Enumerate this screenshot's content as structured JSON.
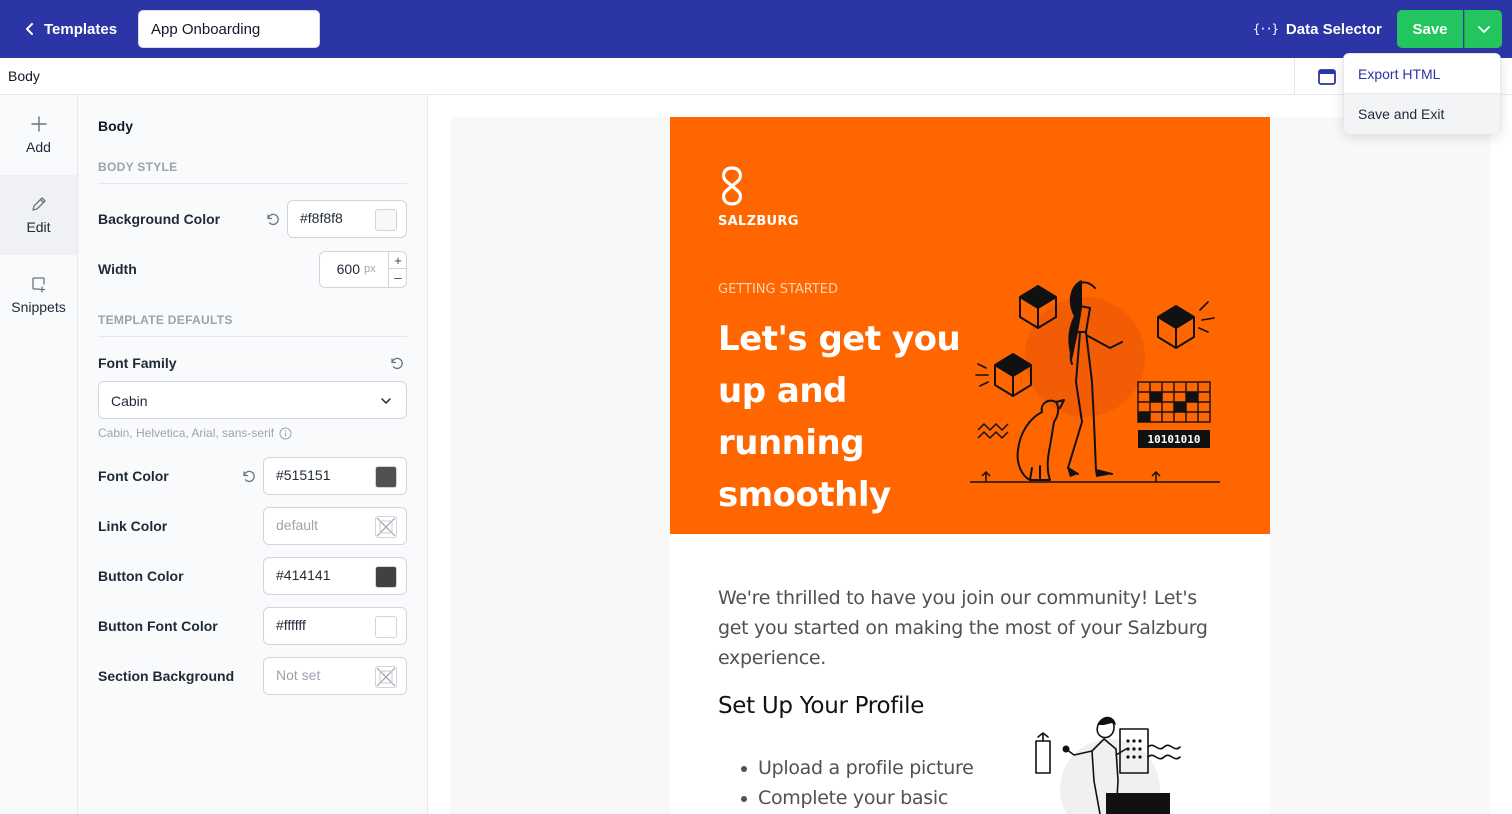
{
  "header": {
    "back_label": "Templates",
    "template_name": "App Onboarding",
    "data_selector_label": "Data Selector",
    "data_selector_icon": "{··}",
    "save_label": "Save",
    "colors": {
      "bar": "#2b35a5",
      "save": "#22c55e"
    }
  },
  "dropdown": {
    "items": [
      {
        "label": "Export HTML"
      },
      {
        "label": "Save and Exit"
      }
    ]
  },
  "breadcrumb": {
    "current": "Body"
  },
  "rail": {
    "items": [
      {
        "label": "Add",
        "icon": "plus-icon"
      },
      {
        "label": "Edit",
        "icon": "pencil-icon",
        "active": true
      },
      {
        "label": "Snippets",
        "icon": "snippet-icon"
      }
    ]
  },
  "panel": {
    "title": "Body",
    "body_style": {
      "heading": "BODY STYLE",
      "background_color": {
        "label": "Background Color",
        "value": "#f8f8f8",
        "swatch": "#f8f8f8"
      },
      "width": {
        "label": "Width",
        "value": "600",
        "unit": "px",
        "increment": "+",
        "decrement": "–"
      }
    },
    "template_defaults": {
      "heading": "TEMPLATE DEFAULTS",
      "font_family": {
        "label": "Font Family",
        "value": "Cabin",
        "hint": "Cabin, Helvetica, Arial, sans-serif"
      },
      "font_color": {
        "label": "Font Color",
        "value": "#515151",
        "swatch": "#515151"
      },
      "link_color": {
        "label": "Link Color",
        "placeholder": "default"
      },
      "button_color": {
        "label": "Button Color",
        "value": "#414141",
        "swatch": "#414141"
      },
      "button_font_color": {
        "label": "Button Font Color",
        "value": "#ffffff",
        "swatch": "#ffffff"
      },
      "section_background": {
        "label": "Section Background",
        "placeholder": "Not set"
      }
    }
  },
  "email": {
    "hero_color": "#ff6600",
    "brand": "SALZBURG",
    "eyebrow": "GETTING STARTED",
    "title": "Let's get you up and running smoothly",
    "illustration_code": "10101010",
    "intro": "We're thrilled to have you join our community! Let's get you started on making the most of your Salzburg experience.",
    "profile_heading": "Set Up Your Profile",
    "profile_items": [
      "Upload a profile picture",
      "Complete your basic"
    ]
  }
}
